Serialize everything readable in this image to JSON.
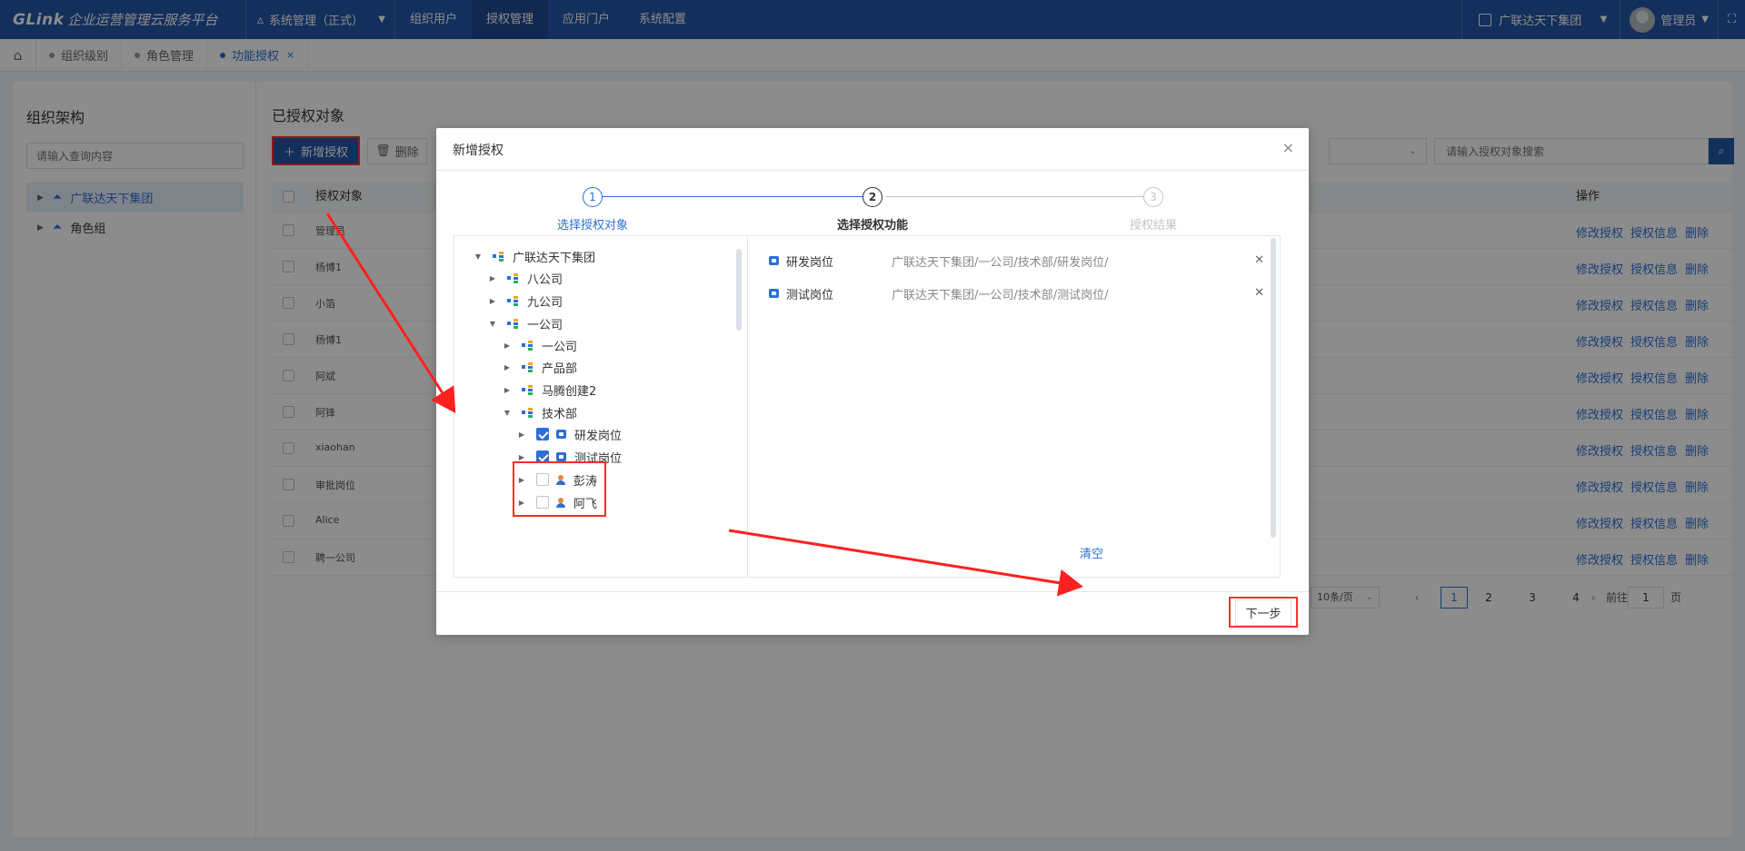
{
  "header": {
    "brand": "GLink",
    "platform": "企业运营管理云服务平台",
    "system": "系统管理（正式）",
    "nav": [
      "组织用户",
      "授权管理",
      "应用门户",
      "系统配置"
    ],
    "active_nav": 1,
    "org": "广联达天下集团",
    "user": "管理员"
  },
  "tabs": [
    {
      "label": "组织级别"
    },
    {
      "label": "角色管理"
    },
    {
      "label": "功能授权"
    }
  ],
  "left": {
    "title": "组织架构",
    "search_placeholder": "请输入查询内容",
    "items": [
      {
        "label": "广联达天下集团"
      },
      {
        "label": "角色组"
      }
    ]
  },
  "right": {
    "title": "已授权对象",
    "add_label": "新增授权",
    "delete_label": "删除",
    "search_placeholder": "请输入授权对象搜索",
    "col_object": "授权对象",
    "col_actions": "操作",
    "rows": [
      "管理员",
      "杨博1",
      "小箔",
      "杨博1",
      "阿斌",
      "阿锋",
      "xiaohan",
      "审批岗位",
      "Alice",
      "聘一公司"
    ],
    "action_edit": "修改授权",
    "action_info": "授权信息",
    "action_delete": "删除",
    "pager": {
      "size": "10条/页",
      "pages": [
        "1",
        "2",
        "3",
        "4"
      ],
      "current": "1",
      "goto": "前往",
      "goto_value": "1",
      "unit": "页"
    }
  },
  "modal": {
    "title": "新增授权",
    "steps": [
      {
        "num": "1",
        "label": "选择授权对象"
      },
      {
        "num": "2",
        "label": "选择授权功能"
      },
      {
        "num": "3",
        "label": "授权结果"
      }
    ],
    "tree": [
      {
        "label": "广联达天下集团"
      },
      {
        "label": "八公司"
      },
      {
        "label": "九公司"
      },
      {
        "label": "一公司"
      },
      {
        "label": "一公司"
      },
      {
        "label": "产品部"
      },
      {
        "label": "马腾创建2"
      },
      {
        "label": "技术部"
      },
      {
        "label": "研发岗位"
      },
      {
        "label": "测试岗位"
      },
      {
        "label": "彭涛"
      },
      {
        "label": "阿飞"
      }
    ],
    "selected": [
      {
        "name": "研发岗位",
        "path": "广联达天下集团/一公司/技术部/研发岗位/"
      },
      {
        "name": "测试岗位",
        "path": "广联达天下集团/一公司/技术部/测试岗位/"
      }
    ],
    "clear_label": "清空",
    "next_label": "下一步"
  }
}
